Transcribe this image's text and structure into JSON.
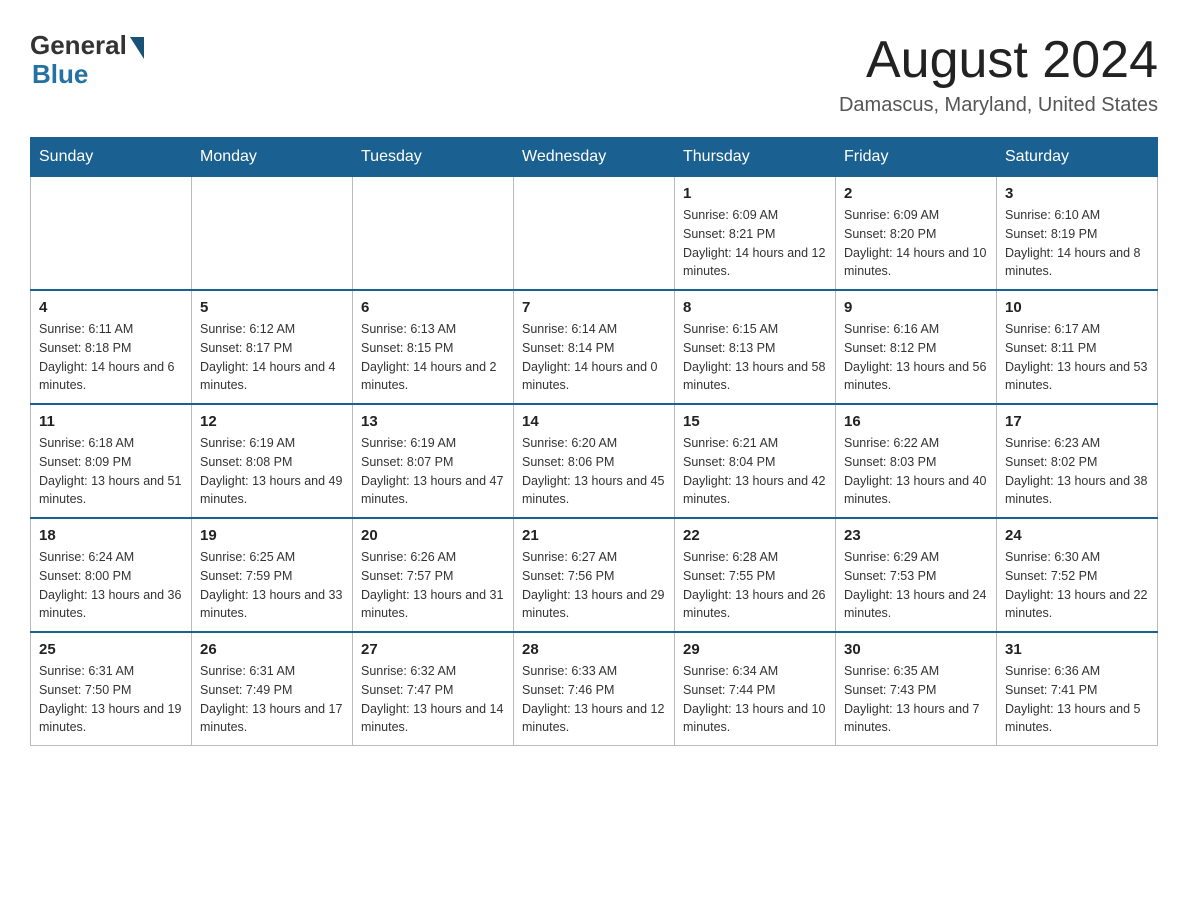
{
  "header": {
    "logo_general": "General",
    "logo_blue": "Blue",
    "month_title": "August 2024",
    "location": "Damascus, Maryland, United States"
  },
  "days_of_week": [
    "Sunday",
    "Monday",
    "Tuesday",
    "Wednesday",
    "Thursday",
    "Friday",
    "Saturday"
  ],
  "weeks": [
    [
      {
        "day": "",
        "info": ""
      },
      {
        "day": "",
        "info": ""
      },
      {
        "day": "",
        "info": ""
      },
      {
        "day": "",
        "info": ""
      },
      {
        "day": "1",
        "info": "Sunrise: 6:09 AM\nSunset: 8:21 PM\nDaylight: 14 hours and 12 minutes."
      },
      {
        "day": "2",
        "info": "Sunrise: 6:09 AM\nSunset: 8:20 PM\nDaylight: 14 hours and 10 minutes."
      },
      {
        "day": "3",
        "info": "Sunrise: 6:10 AM\nSunset: 8:19 PM\nDaylight: 14 hours and 8 minutes."
      }
    ],
    [
      {
        "day": "4",
        "info": "Sunrise: 6:11 AM\nSunset: 8:18 PM\nDaylight: 14 hours and 6 minutes."
      },
      {
        "day": "5",
        "info": "Sunrise: 6:12 AM\nSunset: 8:17 PM\nDaylight: 14 hours and 4 minutes."
      },
      {
        "day": "6",
        "info": "Sunrise: 6:13 AM\nSunset: 8:15 PM\nDaylight: 14 hours and 2 minutes."
      },
      {
        "day": "7",
        "info": "Sunrise: 6:14 AM\nSunset: 8:14 PM\nDaylight: 14 hours and 0 minutes."
      },
      {
        "day": "8",
        "info": "Sunrise: 6:15 AM\nSunset: 8:13 PM\nDaylight: 13 hours and 58 minutes."
      },
      {
        "day": "9",
        "info": "Sunrise: 6:16 AM\nSunset: 8:12 PM\nDaylight: 13 hours and 56 minutes."
      },
      {
        "day": "10",
        "info": "Sunrise: 6:17 AM\nSunset: 8:11 PM\nDaylight: 13 hours and 53 minutes."
      }
    ],
    [
      {
        "day": "11",
        "info": "Sunrise: 6:18 AM\nSunset: 8:09 PM\nDaylight: 13 hours and 51 minutes."
      },
      {
        "day": "12",
        "info": "Sunrise: 6:19 AM\nSunset: 8:08 PM\nDaylight: 13 hours and 49 minutes."
      },
      {
        "day": "13",
        "info": "Sunrise: 6:19 AM\nSunset: 8:07 PM\nDaylight: 13 hours and 47 minutes."
      },
      {
        "day": "14",
        "info": "Sunrise: 6:20 AM\nSunset: 8:06 PM\nDaylight: 13 hours and 45 minutes."
      },
      {
        "day": "15",
        "info": "Sunrise: 6:21 AM\nSunset: 8:04 PM\nDaylight: 13 hours and 42 minutes."
      },
      {
        "day": "16",
        "info": "Sunrise: 6:22 AM\nSunset: 8:03 PM\nDaylight: 13 hours and 40 minutes."
      },
      {
        "day": "17",
        "info": "Sunrise: 6:23 AM\nSunset: 8:02 PM\nDaylight: 13 hours and 38 minutes."
      }
    ],
    [
      {
        "day": "18",
        "info": "Sunrise: 6:24 AM\nSunset: 8:00 PM\nDaylight: 13 hours and 36 minutes."
      },
      {
        "day": "19",
        "info": "Sunrise: 6:25 AM\nSunset: 7:59 PM\nDaylight: 13 hours and 33 minutes."
      },
      {
        "day": "20",
        "info": "Sunrise: 6:26 AM\nSunset: 7:57 PM\nDaylight: 13 hours and 31 minutes."
      },
      {
        "day": "21",
        "info": "Sunrise: 6:27 AM\nSunset: 7:56 PM\nDaylight: 13 hours and 29 minutes."
      },
      {
        "day": "22",
        "info": "Sunrise: 6:28 AM\nSunset: 7:55 PM\nDaylight: 13 hours and 26 minutes."
      },
      {
        "day": "23",
        "info": "Sunrise: 6:29 AM\nSunset: 7:53 PM\nDaylight: 13 hours and 24 minutes."
      },
      {
        "day": "24",
        "info": "Sunrise: 6:30 AM\nSunset: 7:52 PM\nDaylight: 13 hours and 22 minutes."
      }
    ],
    [
      {
        "day": "25",
        "info": "Sunrise: 6:31 AM\nSunset: 7:50 PM\nDaylight: 13 hours and 19 minutes."
      },
      {
        "day": "26",
        "info": "Sunrise: 6:31 AM\nSunset: 7:49 PM\nDaylight: 13 hours and 17 minutes."
      },
      {
        "day": "27",
        "info": "Sunrise: 6:32 AM\nSunset: 7:47 PM\nDaylight: 13 hours and 14 minutes."
      },
      {
        "day": "28",
        "info": "Sunrise: 6:33 AM\nSunset: 7:46 PM\nDaylight: 13 hours and 12 minutes."
      },
      {
        "day": "29",
        "info": "Sunrise: 6:34 AM\nSunset: 7:44 PM\nDaylight: 13 hours and 10 minutes."
      },
      {
        "day": "30",
        "info": "Sunrise: 6:35 AM\nSunset: 7:43 PM\nDaylight: 13 hours and 7 minutes."
      },
      {
        "day": "31",
        "info": "Sunrise: 6:36 AM\nSunset: 7:41 PM\nDaylight: 13 hours and 5 minutes."
      }
    ]
  ]
}
